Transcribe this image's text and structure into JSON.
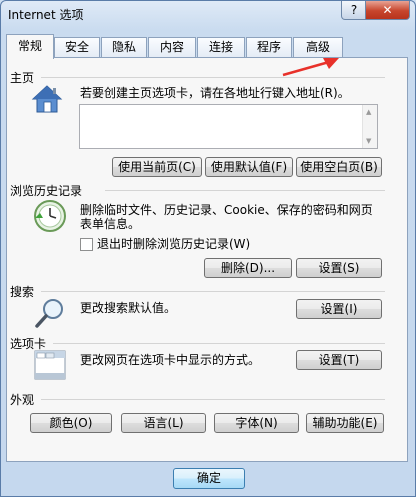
{
  "window": {
    "title": "Internet 选项",
    "help_label": "?",
    "close_label": "✕"
  },
  "tabs": [
    {
      "label": "常规",
      "active": true
    },
    {
      "label": "安全"
    },
    {
      "label": "隐私"
    },
    {
      "label": "内容"
    },
    {
      "label": "连接"
    },
    {
      "label": "程序"
    },
    {
      "label": "高级"
    }
  ],
  "home": {
    "title": "主页",
    "description": "若要创建主页选项卡，请在各地址行键入地址(R)。",
    "value": "",
    "buttons": {
      "current": "使用当前页(C)",
      "default": "使用默认值(F)",
      "blank": "使用空白页(B)"
    },
    "icon": "house-icon"
  },
  "history": {
    "title": "浏览历史记录",
    "description_line1": "删除临时文件、历史记录、Cookie、保存的密码和网页",
    "description_line2": "表单信息。",
    "checkbox_label": "退出时删除浏览历史记录(W)",
    "checkbox_checked": false,
    "buttons": {
      "delete": "删除(D)...",
      "settings": "设置(S)"
    },
    "icon": "history-clock-icon"
  },
  "search": {
    "title": "搜索",
    "description": "更改搜索默认值。",
    "settings_label": "设置(I)",
    "icon": "magnifier-icon"
  },
  "tabs_section": {
    "title": "选项卡",
    "description": "更改网页在选项卡中显示的方式。",
    "settings_label": "设置(T)",
    "icon": "tabs-window-icon"
  },
  "appearance": {
    "title": "外观",
    "buttons": {
      "colors": "颜色(O)",
      "languages": "语言(L)",
      "fonts": "字体(N)",
      "accessibility": "辅助功能(E)"
    }
  },
  "footer": {
    "ok_label": "确定"
  },
  "colors": {
    "annotation_arrow": "#e8312a",
    "close_red": "#c7452c",
    "ok_border": "#3c7fb1"
  }
}
